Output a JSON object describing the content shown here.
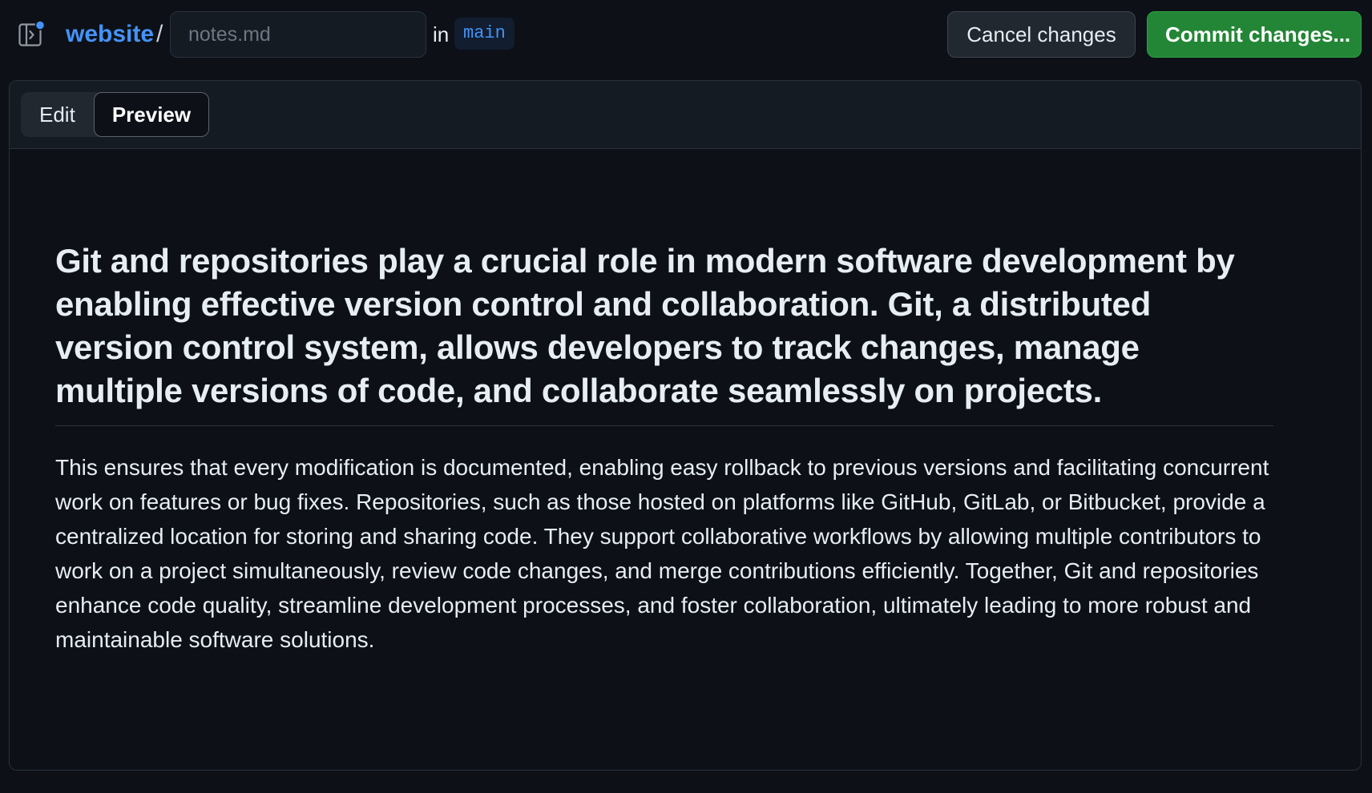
{
  "header": {
    "repo_name": "website",
    "separator": "/",
    "filename_placeholder": "notes.md",
    "in_label": "in",
    "branch": "main",
    "cancel_label": "Cancel changes",
    "commit_label": "Commit changes..."
  },
  "tabs": [
    {
      "label": "Edit",
      "active": false
    },
    {
      "label": "Preview",
      "active": true
    }
  ],
  "preview": {
    "heading": "Git and repositories play a crucial role in modern software development by enabling effective version control and collaboration. Git, a distributed version control system, allows developers to track changes, manage multiple versions of code, and collaborate seamlessly on projects.",
    "paragraph": "This ensures that every modification is documented, enabling easy rollback to previous versions and facilitating concurrent work on features or bug fixes. Repositories, such as those hosted on platforms like GitHub, GitLab, or Bitbucket, provide a centralized location for storing and sharing code. They support collaborative workflows by allowing multiple contributors to work on a project simultaneously, review code changes, and merge contributions efficiently. Together, Git and repositories enhance code quality, streamline development processes, and foster collaboration, ultimately leading to more robust and maintainable software solutions."
  },
  "icons": {
    "sidebar_toggle": "sidebar-toggle-icon",
    "notification_dot": "notification-dot-icon"
  },
  "colors": {
    "background": "#0d1117",
    "accent_link": "#4493f8",
    "commit_button": "#238636"
  }
}
